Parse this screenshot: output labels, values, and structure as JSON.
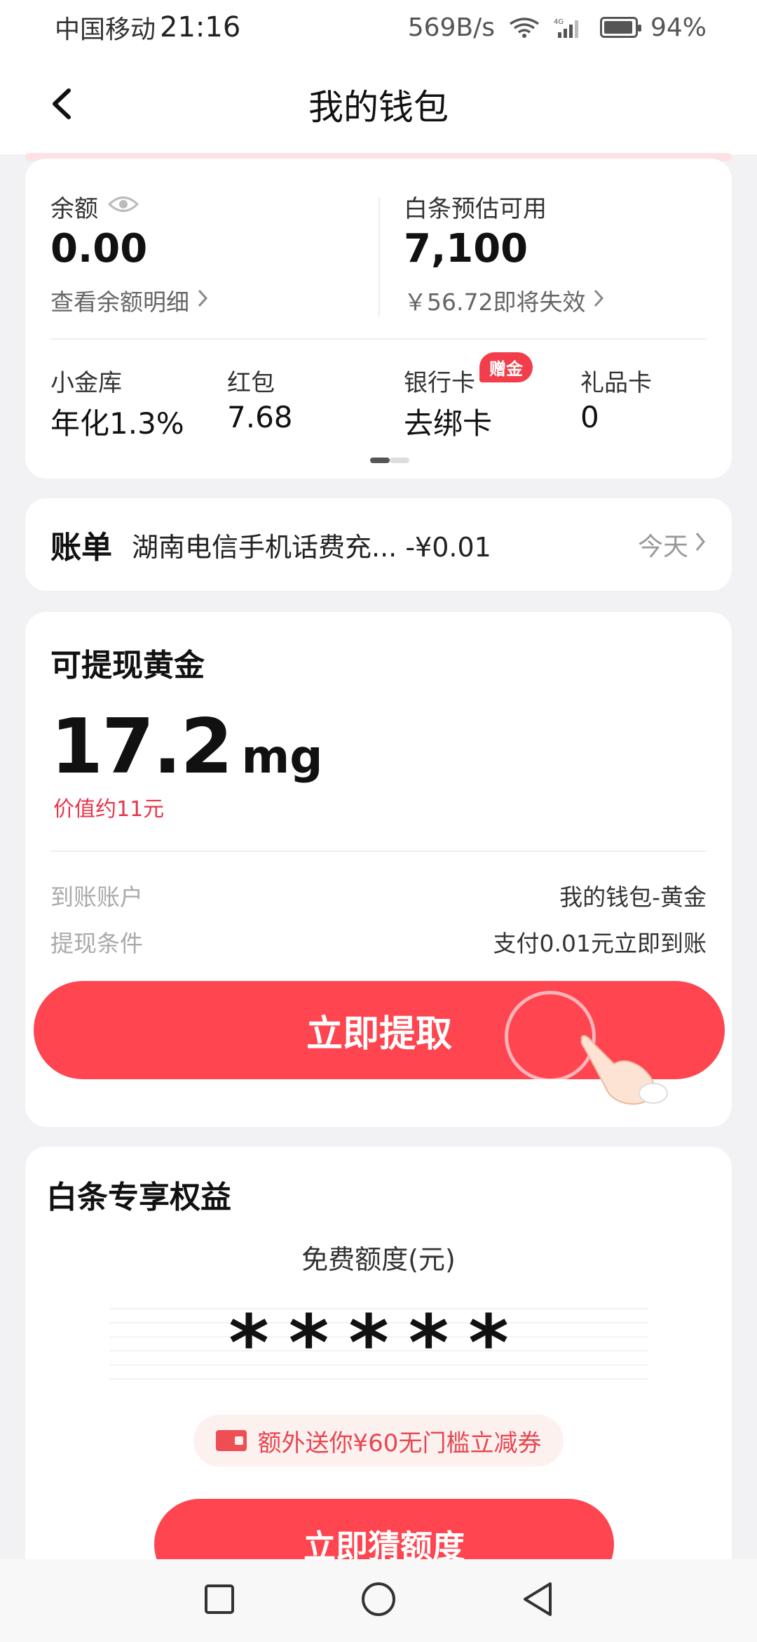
{
  "statusbar": {
    "carrier": "中国移动",
    "time": "21:16",
    "speed": "569B/s",
    "battery": "94%",
    "network": "4G"
  },
  "header": {
    "title": "我的钱包"
  },
  "wallet": {
    "balance_label": "余额",
    "balance_value": "0.00",
    "balance_link": "查看余额明细",
    "credit_label": "白条预估可用",
    "credit_value": "7,100",
    "credit_link": "￥56.72即将失效",
    "items": [
      {
        "label": "小金库",
        "value": "年化1.3%"
      },
      {
        "label": "红包",
        "value": "7.68"
      },
      {
        "label": "银行卡",
        "value": "去绑卡",
        "badge": "赠金"
      },
      {
        "label": "礼品卡",
        "value": "0"
      }
    ]
  },
  "bill": {
    "title": "账单",
    "desc": "湖南电信手机话费充... -¥0.01",
    "date": "今天"
  },
  "gold": {
    "title": "可提现黄金",
    "amount": "17.2",
    "unit": "mg",
    "worth": "价值约11元",
    "account_label": "到账账户",
    "account_value": "我的钱包-黄金",
    "condition_label": "提现条件",
    "condition_value": "支付0.01元立即到账",
    "button": "立即提取"
  },
  "baitiao": {
    "title": "白条专享权益",
    "quota_label": "免费额度(元)",
    "stars": "*****",
    "coupon": "额外送你¥60无门槛立减券",
    "button": "立即猜额度"
  },
  "colors": {
    "accent": "#fe4550",
    "badge": "#f23d4a",
    "page_bg": "#f2f2f4"
  }
}
